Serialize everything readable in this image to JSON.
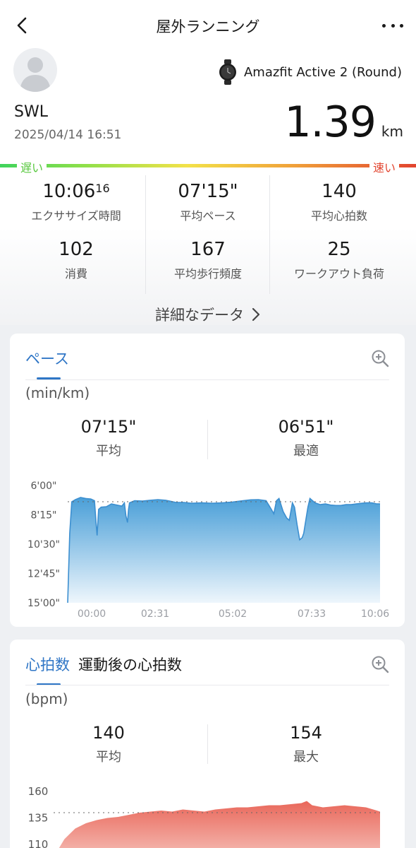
{
  "header": {
    "title": "屋外ランニング"
  },
  "profile": {
    "user_name": "SWL",
    "datetime": "2025/04/14 16:51"
  },
  "device": {
    "name": "Amazfit Active 2 (Round)"
  },
  "distance": {
    "value": "1.39",
    "unit": "km"
  },
  "pace_scale": {
    "slow": "遅い",
    "fast": "速い"
  },
  "stats": [
    {
      "value": "10:06",
      "sup": "16",
      "label": "エクササイズ時間"
    },
    {
      "value": "07'15\"",
      "label": "平均ペース"
    },
    {
      "value": "140",
      "label": "平均心拍数"
    },
    {
      "value": "102",
      "label": "消費"
    },
    {
      "value": "167",
      "label": "平均歩行頻度"
    },
    {
      "value": "25",
      "label": "ワークアウト負荷"
    }
  ],
  "detail_link": {
    "label": "詳細なデータ"
  },
  "pace_card": {
    "tab": "ペース",
    "unit": "(min/km)",
    "avg_value": "07'15\"",
    "avg_label": "平均",
    "best_value": "06'51\"",
    "best_label": "最適",
    "colors": {
      "fill_top": "#4a9fd8",
      "fill_bottom": "#eef6fc",
      "line": "#3c8fd0"
    }
  },
  "hr_card": {
    "tabs": [
      "心拍数",
      "運動後の心拍数"
    ],
    "unit": "(bpm)",
    "avg_value": "140",
    "avg_label": "平均",
    "max_value": "154",
    "max_label": "最大",
    "colors": {
      "fill_top": "#e9675a",
      "fill_bottom": "#f7c9c2"
    }
  },
  "chart_data": [
    {
      "type": "area",
      "y_axis_inverted": true,
      "y_unit": "min/km",
      "ytick_labels": [
        "6'00\"",
        "8'15\"",
        "10'30\"",
        "12'45\"",
        "15'00\""
      ],
      "yticks_sec": [
        360,
        495,
        630,
        765,
        900
      ],
      "xtick_labels": [
        "00:00",
        "02:31",
        "05:02",
        "07:33",
        "10:06"
      ],
      "ylim_sec": [
        360,
        900
      ],
      "xlim_sec": [
        0,
        606
      ],
      "reference_line_sec": 435,
      "x_sec": [
        0,
        4,
        8,
        15,
        25,
        35,
        45,
        52,
        55,
        57,
        60,
        65,
        75,
        85,
        95,
        105,
        110,
        113,
        116,
        118,
        120,
        130,
        145,
        160,
        175,
        190,
        200,
        210,
        225,
        240,
        260,
        280,
        300,
        320,
        340,
        355,
        370,
        385,
        395,
        400,
        405,
        410,
        418,
        425,
        430,
        433,
        436,
        440,
        445,
        450,
        455,
        458,
        462,
        466,
        470,
        475,
        480,
        490,
        500,
        510,
        520,
        530,
        540,
        550,
        560,
        570,
        580,
        590,
        600,
        606
      ],
      "y_sec": [
        900,
        580,
        435,
        425,
        415,
        420,
        422,
        430,
        530,
        590,
        470,
        460,
        458,
        445,
        450,
        455,
        440,
        500,
        530,
        470,
        440,
        430,
        432,
        428,
        425,
        428,
        433,
        438,
        438,
        442,
        440,
        442,
        440,
        436,
        430,
        426,
        425,
        430,
        470,
        490,
        430,
        420,
        480,
        510,
        520,
        480,
        440,
        460,
        540,
        610,
        600,
        580,
        520,
        460,
        420,
        430,
        440,
        448,
        445,
        450,
        452,
        452,
        448,
        448,
        445,
        442,
        440,
        440,
        445,
        445
      ]
    },
    {
      "type": "area",
      "y_unit": "bpm",
      "ytick_labels": [
        "160",
        "135",
        "110"
      ],
      "yticks": [
        160,
        135,
        110
      ],
      "reference_line": 140,
      "ylim": [
        110,
        160
      ],
      "x": [
        0,
        20,
        40,
        60,
        80,
        100,
        120,
        140,
        160,
        180,
        200,
        220,
        240,
        260,
        280,
        300,
        320,
        340,
        360,
        380,
        400,
        420,
        440,
        460,
        470,
        480,
        490,
        500,
        520,
        540,
        560,
        580,
        600,
        606
      ],
      "y": [
        98,
        115,
        125,
        130,
        133,
        135,
        136,
        138,
        140,
        141,
        142,
        141,
        143,
        142,
        141,
        143,
        144,
        145,
        145,
        146,
        147,
        147,
        148,
        149,
        151,
        147,
        146,
        145,
        146,
        147,
        146,
        145,
        142,
        141
      ]
    }
  ]
}
